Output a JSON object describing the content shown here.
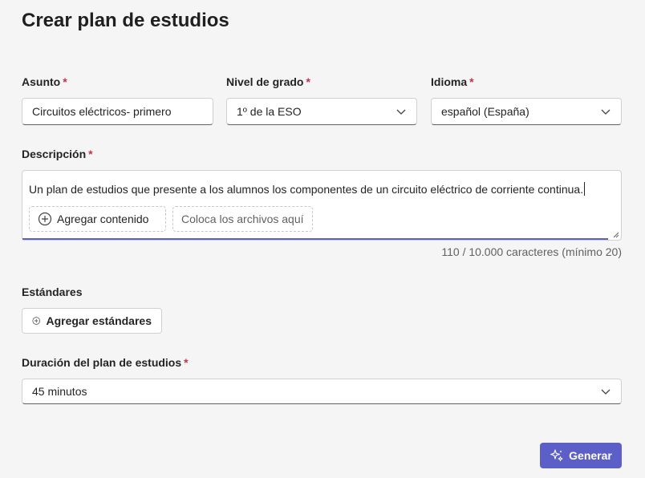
{
  "page": {
    "title": "Crear plan de estudios"
  },
  "required_mark": "*",
  "subject": {
    "label": "Asunto",
    "value": "Circuitos eléctricos- primero"
  },
  "grade": {
    "label": "Nivel de grado",
    "value": "1º de la ESO"
  },
  "language": {
    "label": "Idioma",
    "value": "español (España)"
  },
  "description": {
    "label": "Descripción",
    "value": "Un plan de estudios que presente a los alumnos los componentes de un circuito eléctrico de corriente continua.",
    "add_content_label": "Agregar contenido",
    "drop_files_label": "Coloca los archivos aquí",
    "counter": "110 / 10.000 caracteres (mínimo 20)"
  },
  "standards": {
    "label": "Estándares",
    "add_label": "Agregar estándares"
  },
  "duration": {
    "label": "Duración del plan de estudios",
    "value": "45 minutos"
  },
  "generate": {
    "label": "Generar"
  },
  "icons": {
    "chevron": "chevron-down-icon",
    "add": "add-circle-icon",
    "sparkle": "sparkle-icon",
    "resize": "resize-grip-icon"
  },
  "colors": {
    "accent": "#5b5fc7",
    "required": "#c4314b",
    "background": "#f5f5f5"
  }
}
